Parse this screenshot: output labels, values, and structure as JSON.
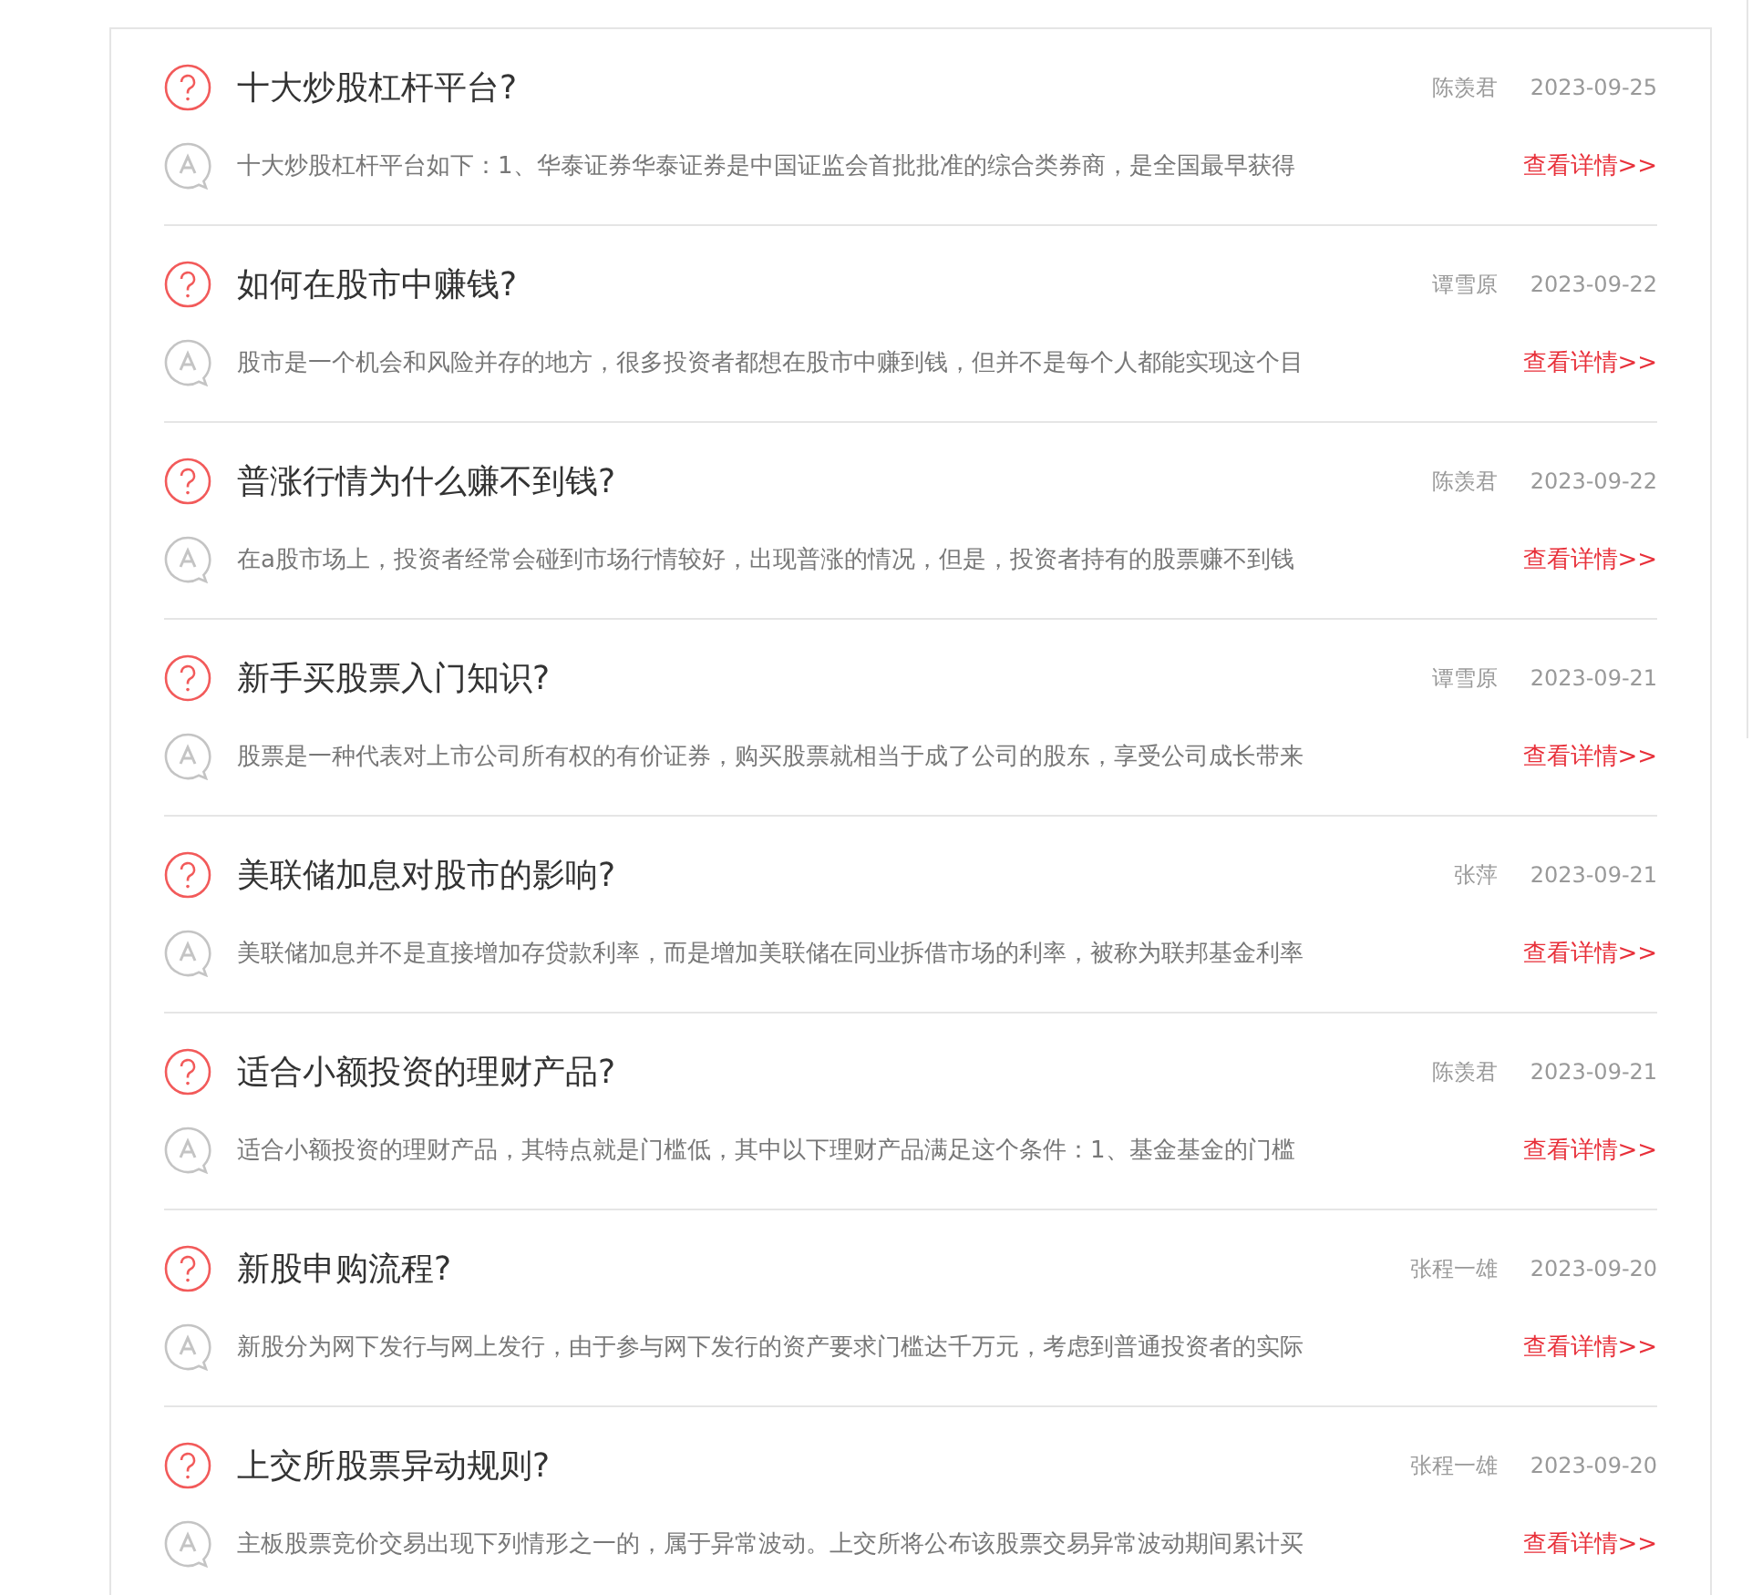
{
  "questions": [
    {
      "title": "十大炒股杠杆平台?",
      "author": "陈羡君",
      "date": "2023-09-25",
      "answer": "十大炒股杠杆平台如下：1、华泰证券华泰证券是中国证监会首批批准的综合类券商，是全国最早获得",
      "link": "查看详情>>"
    },
    {
      "title": "如何在股市中赚钱?",
      "author": "谭雪原",
      "date": "2023-09-22",
      "answer": "股市是一个机会和风险并存的地方，很多投资者都想在股市中赚到钱，但并不是每个人都能实现这个目",
      "link": "查看详情>>"
    },
    {
      "title": "普涨行情为什么赚不到钱?",
      "author": "陈羡君",
      "date": "2023-09-22",
      "answer": "在a股市场上，投资者经常会碰到市场行情较好，出现普涨的情况，但是，投资者持有的股票赚不到钱",
      "link": "查看详情>>"
    },
    {
      "title": "新手买股票入门知识?",
      "author": "谭雪原",
      "date": "2023-09-21",
      "answer": "股票是一种代表对上市公司所有权的有价证券，购买股票就相当于成了公司的股东，享受公司成长带来",
      "link": "查看详情>>"
    },
    {
      "title": "美联储加息对股市的影响?",
      "author": "张萍",
      "date": "2023-09-21",
      "answer": "美联储加息并不是直接增加存贷款利率，而是增加美联储在同业拆借市场的利率，被称为联邦基金利率",
      "link": "查看详情>>"
    },
    {
      "title": "适合小额投资的理财产品?",
      "author": "陈羡君",
      "date": "2023-09-21",
      "answer": "适合小额投资的理财产品，其特点就是门槛低，其中以下理财产品满足这个条件：1、基金基金的门槛",
      "link": "查看详情>>"
    },
    {
      "title": "新股申购流程?",
      "author": "张程一雄",
      "date": "2023-09-20",
      "answer": "新股分为网下发行与网上发行，由于参与网下发行的资产要求门槛达千万元，考虑到普通投资者的实际",
      "link": "查看详情>>"
    },
    {
      "title": "上交所股票异动规则?",
      "author": "张程一雄",
      "date": "2023-09-20",
      "answer": "主板股票竞价交易出现下列情形之一的，属于异常波动。上交所将公布该股票交易异常波动期间累计买",
      "link": "查看详情>>"
    }
  ]
}
